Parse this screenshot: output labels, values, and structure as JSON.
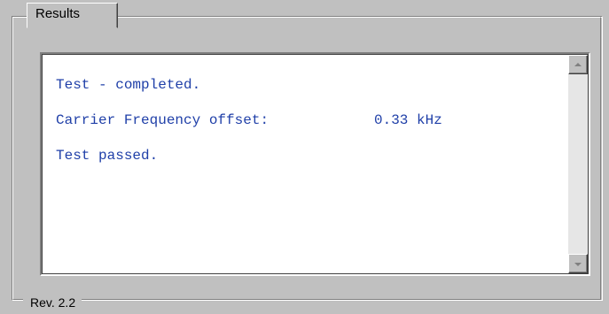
{
  "group": {
    "title": "Results",
    "footer": "Rev. 2.2"
  },
  "output": {
    "line1": "Test - completed.",
    "line2_label": "Carrier Frequency offset:",
    "line2_value": "0.33 kHz",
    "line3": "Test passed."
  },
  "scrollbar": {
    "up_icon": "arrow-up-icon",
    "down_icon": "arrow-down-icon"
  },
  "colors": {
    "background": "#c0c0c0",
    "text_output": "#1f3fa8",
    "panel": "#ffffff"
  }
}
